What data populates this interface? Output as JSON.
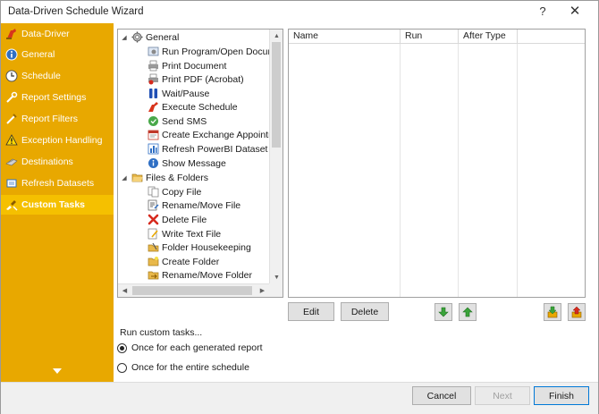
{
  "window": {
    "title": "Data-Driven Schedule Wizard",
    "help_label": "?",
    "close_label": "✕"
  },
  "sidebar": {
    "items": [
      {
        "label": "Data-Driver",
        "icon": "data-driver-icon"
      },
      {
        "label": "General",
        "icon": "info-icon"
      },
      {
        "label": "Schedule",
        "icon": "clock-icon"
      },
      {
        "label": "Report Settings",
        "icon": "settings-icon"
      },
      {
        "label": "Report Filters",
        "icon": "filter-icon"
      },
      {
        "label": "Exception Handling",
        "icon": "warning-icon"
      },
      {
        "label": "Destinations",
        "icon": "destinations-icon"
      },
      {
        "label": "Refresh Datasets",
        "icon": "refresh-datasets-icon"
      },
      {
        "label": "Custom Tasks",
        "icon": "custom-tasks-icon"
      }
    ],
    "active_index": 8
  },
  "tree": {
    "groups": [
      {
        "label": "General",
        "icon": "gear-icon",
        "items": [
          {
            "label": "Run Program/Open Document",
            "icon": "run-program-icon"
          },
          {
            "label": "Print Document",
            "icon": "printer-icon"
          },
          {
            "label": "Print PDF (Acrobat)",
            "icon": "pdf-printer-icon"
          },
          {
            "label": "Wait/Pause",
            "icon": "pause-icon"
          },
          {
            "label": "Execute Schedule",
            "icon": "execute-icon"
          },
          {
            "label": "Send SMS",
            "icon": "sms-icon"
          },
          {
            "label": "Create Exchange Appointment",
            "icon": "calendar-icon"
          },
          {
            "label": "Refresh PowerBI Dataset",
            "icon": "powerbi-icon"
          },
          {
            "label": "Show Message",
            "icon": "message-icon"
          }
        ]
      },
      {
        "label": "Files & Folders",
        "icon": "folder-open-icon",
        "items": [
          {
            "label": "Copy File",
            "icon": "copy-file-icon"
          },
          {
            "label": "Rename/Move File",
            "icon": "rename-file-icon"
          },
          {
            "label": "Delete File",
            "icon": "delete-icon"
          },
          {
            "label": "Write Text File",
            "icon": "write-file-icon"
          },
          {
            "label": "Folder Housekeeping",
            "icon": "housekeeping-icon"
          },
          {
            "label": "Create Folder",
            "icon": "new-folder-icon"
          },
          {
            "label": "Rename/Move Folder",
            "icon": "rename-folder-icon"
          }
        ]
      }
    ]
  },
  "grid": {
    "columns": [
      "Name",
      "Run",
      "After Type"
    ],
    "rows": []
  },
  "actions": {
    "edit_label": "Edit",
    "delete_label": "Delete"
  },
  "run_options": {
    "label": "Run custom tasks...",
    "options": [
      "Once for each generated report",
      "Once for the entire schedule"
    ],
    "selected_index": 0
  },
  "footer": {
    "cancel_label": "Cancel",
    "next_label": "Next",
    "finish_label": "Finish"
  },
  "colors": {
    "sidebar": "#e8a800",
    "sidebar_active": "#f5c000"
  }
}
